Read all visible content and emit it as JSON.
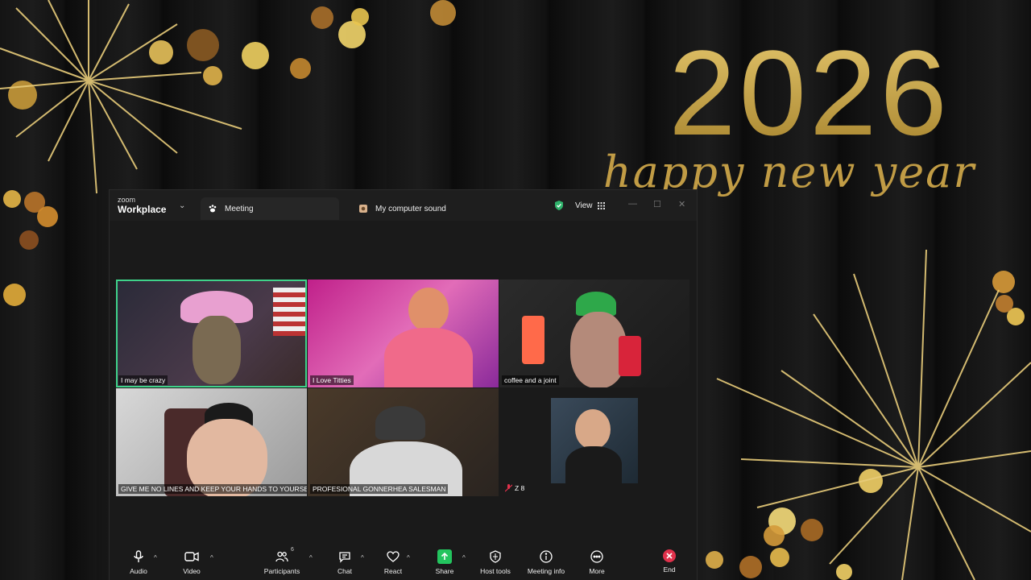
{
  "background": {
    "year": "2026",
    "greeting": "happy new year",
    "colors": {
      "gold": "#c9a449",
      "wood": "#151515"
    }
  },
  "window": {
    "brand_small": "zoom",
    "brand_main": "Workplace",
    "tabs": [
      {
        "label": "Meeting",
        "icon": "paw-icon"
      },
      {
        "label": "My computer sound",
        "icon": "speaker-icon"
      }
    ],
    "view_label": "View",
    "security_color": "#2fb36b"
  },
  "participants": [
    {
      "name": "I may be crazy",
      "speaking": true
    },
    {
      "name": "I Love Titties",
      "speaking": false
    },
    {
      "name": "coffee and a joint",
      "speaking": false
    },
    {
      "name": "GIVE ME NO LINES AND KEEP YOUR HANDS TO YOURSELF",
      "speaking": false
    },
    {
      "name": "PROFESIONAL GONNERHEA SALESMAN",
      "speaking": false
    },
    {
      "name": "Z 8",
      "speaking": false,
      "muted": true
    }
  ],
  "toolbar": {
    "audio": "Audio",
    "video": "Video",
    "participants": "Participants",
    "participant_count": "6",
    "chat": "Chat",
    "react": "React",
    "share": "Share",
    "host_tools": "Host tools",
    "meeting_info": "Meeting info",
    "more": "More",
    "end": "End",
    "share_color": "#23c45e",
    "end_color": "#e0314b"
  }
}
